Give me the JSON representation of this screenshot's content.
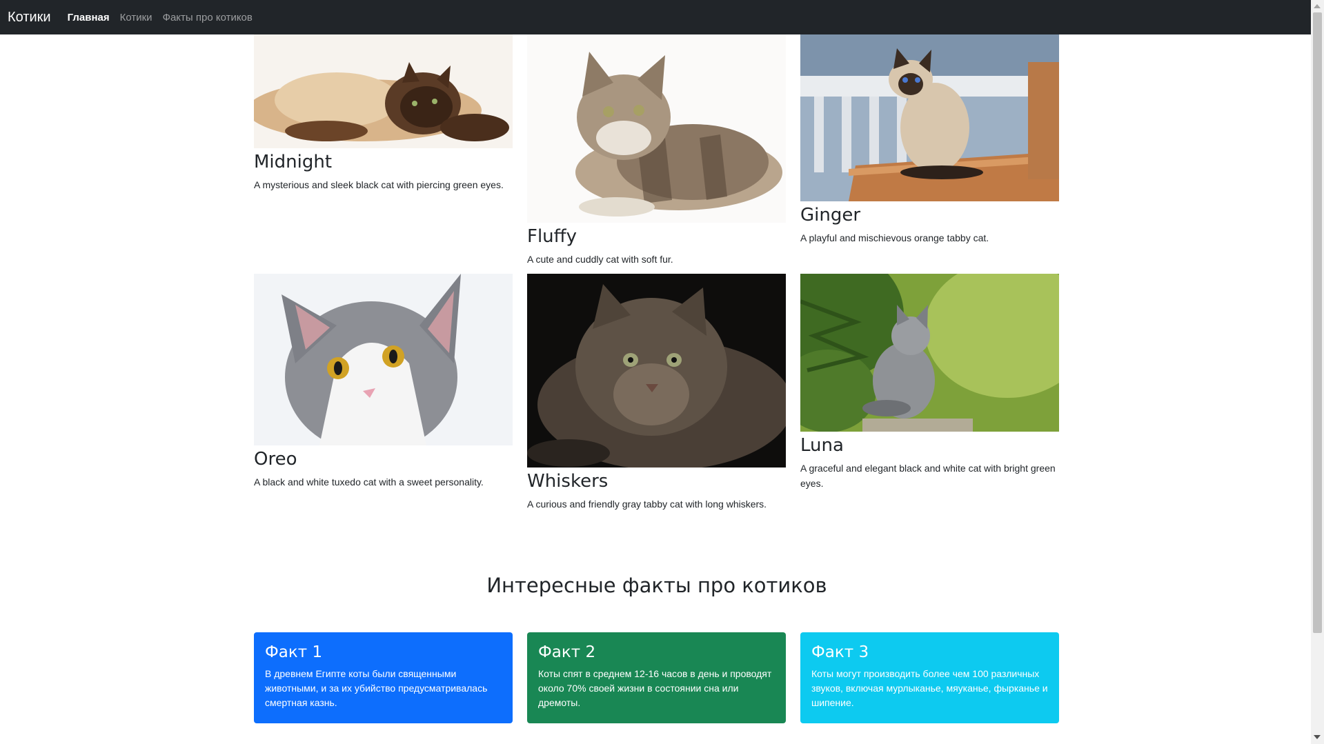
{
  "navbar": {
    "brand": "Котики",
    "links": [
      {
        "label": "Главная"
      },
      {
        "label": "Котики"
      },
      {
        "label": "Факты про котиков"
      }
    ]
  },
  "cats": [
    {
      "name": "Midnight",
      "description": "A mysterious and sleek black cat with piercing green eyes."
    },
    {
      "name": "Fluffy",
      "description": "A cute and cuddly cat with soft fur."
    },
    {
      "name": "Ginger",
      "description": "A playful and mischievous orange tabby cat."
    },
    {
      "name": "Oreo",
      "description": "A black and white tuxedo cat with a sweet personality."
    },
    {
      "name": "Whiskers",
      "description": "A curious and friendly gray tabby cat with long whiskers."
    },
    {
      "name": "Luna",
      "description": "A graceful and elegant black and white cat with bright green eyes."
    }
  ],
  "facts": {
    "title": "Интересные факты про котиков",
    "items": [
      {
        "title": "Факт 1",
        "text": "В древнем Египте коты были священными животными, и за их убийство предусматривалась смертная казнь.",
        "color": "#0d6efd"
      },
      {
        "title": "Факт 2",
        "text": "Коты спят в среднем 12-16 часов в день и проводят около 70% своей жизни в состоянии сна или дремоты.",
        "color": "#198754"
      },
      {
        "title": "Факт 3",
        "text": "Коты могут производить более чем 100 различных звуков, включая мурлыканье, мяуканье, фырканье и шипение.",
        "color": "#0dcaf0"
      }
    ]
  },
  "colors": {
    "navbar_bg": "#212529",
    "primary": "#0d6efd",
    "success": "#198754",
    "info": "#0dcaf0"
  }
}
